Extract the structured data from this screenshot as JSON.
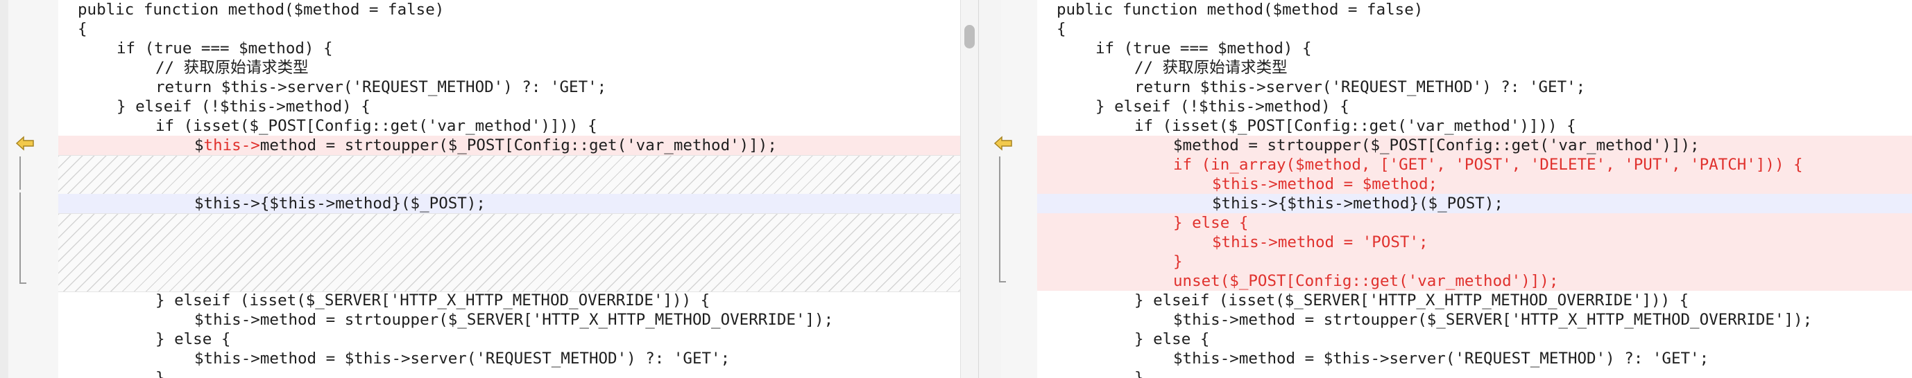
{
  "left_pane": {
    "lines": [
      {
        "indent": 0,
        "text": "public function method($method = false)"
      },
      {
        "indent": 0,
        "text": "{"
      },
      {
        "indent": 1,
        "text": "if (true === $method) {"
      },
      {
        "indent": 2,
        "text": "// 获取原始请求类型"
      },
      {
        "indent": 2,
        "text": "return $this->server('REQUEST_METHOD') ?: 'GET';"
      },
      {
        "indent": 1,
        "text": "} elseif (!$this->method) {"
      },
      {
        "indent": 2,
        "text": "if (isset($_POST[Config::get('var_method')])) {"
      },
      {
        "indent": 3,
        "pre": "$",
        "red": "this->",
        "post": "method = strtoupper($_POST[Config::get('var_method')]);",
        "style": "del"
      },
      {
        "indent": 3,
        "text": "$this->{$this->method}($_POST);",
        "style": "cur"
      },
      {
        "indent": 2,
        "text": "} elseif (isset($_SERVER['HTTP_X_HTTP_METHOD_OVERRIDE'])) {"
      },
      {
        "indent": 3,
        "text": "$this->method = strtoupper($_SERVER['HTTP_X_HTTP_METHOD_OVERRIDE']);"
      },
      {
        "indent": 2,
        "text": "} else {"
      },
      {
        "indent": 3,
        "text": "$this->method = $this->server('REQUEST_METHOD') ?: 'GET';"
      },
      {
        "indent": 2,
        "text": "}"
      }
    ]
  },
  "right_pane": {
    "lines": [
      {
        "indent": 0,
        "text": "public function method($method = false)"
      },
      {
        "indent": 0,
        "text": "{"
      },
      {
        "indent": 1,
        "text": "if (true === $method) {"
      },
      {
        "indent": 2,
        "text": "// 获取原始请求类型"
      },
      {
        "indent": 2,
        "text": "return $this->server('REQUEST_METHOD') ?: 'GET';"
      },
      {
        "indent": 1,
        "text": "} elseif (!$this->method) {"
      },
      {
        "indent": 2,
        "text": "if (isset($_POST[Config::get('var_method')])) {"
      },
      {
        "indent": 3,
        "text": "$method = strtoupper($_POST[Config::get('var_method')]);",
        "style": "mod"
      },
      {
        "indent": 3,
        "text": "if (in_array($method, ['GET', 'POST', 'DELETE', 'PUT', 'PATCH'])) {",
        "style": "mod",
        "color": "red"
      },
      {
        "indent": 4,
        "text": "$this->method = $method;",
        "style": "mod",
        "color": "red"
      },
      {
        "indent": 4,
        "text": "$this->{$this->method}($_POST);",
        "style": "cur"
      },
      {
        "indent": 3,
        "text": "} else {",
        "style": "mod",
        "color": "red"
      },
      {
        "indent": 4,
        "text": "$this->method = 'POST';",
        "style": "mod",
        "color": "red"
      },
      {
        "indent": 3,
        "text": "}",
        "style": "mod",
        "color": "red"
      },
      {
        "indent": 3,
        "text": "unset($_POST[Config::get('var_method')]);",
        "style": "mod",
        "color": "red"
      },
      {
        "indent": 2,
        "text": "} elseif (isset($_SERVER['HTTP_X_HTTP_METHOD_OVERRIDE'])) {"
      },
      {
        "indent": 3,
        "text": "$this->method = strtoupper($_SERVER['HTTP_X_HTTP_METHOD_OVERRIDE']);"
      },
      {
        "indent": 2,
        "text": "} else {"
      },
      {
        "indent": 3,
        "text": "$this->method = $this->server('REQUEST_METHOD') ?: 'GET';"
      },
      {
        "indent": 2,
        "text": "}"
      }
    ]
  },
  "colors": {
    "deleted_bg": "#fde8e8",
    "current_bg": "#eceefd",
    "changed_text": "#e0312d",
    "marker_arrow": "#f2c94c"
  },
  "icons": {
    "left_marker": "diff-arrow-icon",
    "right_marker": "diff-arrow-icon"
  }
}
